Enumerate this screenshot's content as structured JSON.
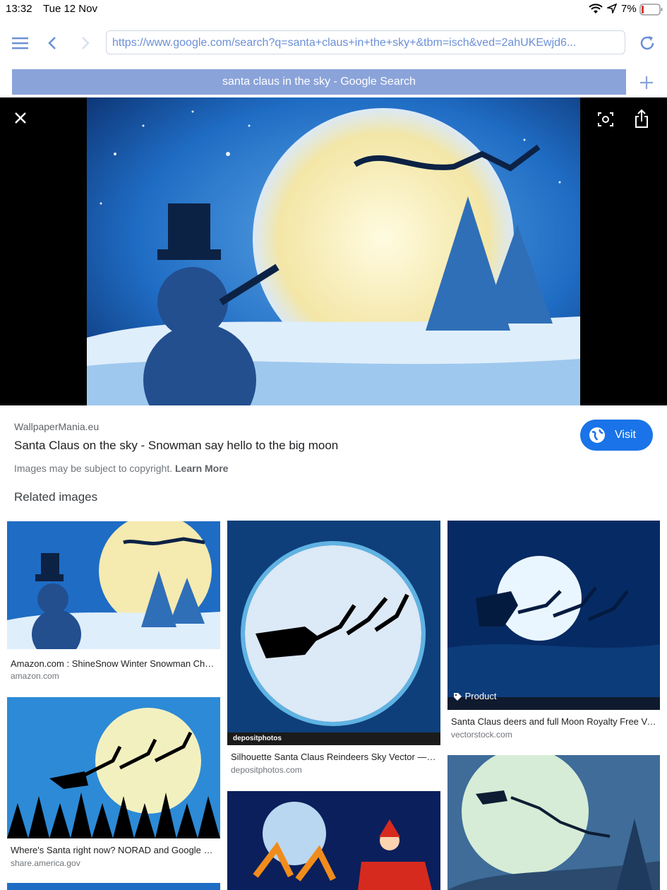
{
  "status_bar": {
    "time": "13:32",
    "date": "Tue 12 Nov",
    "battery": "7%"
  },
  "browser": {
    "url": "https://www.google.com/search?q=santa+claus+in+the+sky+&tbm=isch&ved=2ahUKEwjd6...",
    "tab_title": "santa claus in the sky - Google Search"
  },
  "result": {
    "source": "WallpaperMania.eu",
    "title": "Santa Claus on the sky - Snowman say hello to the big moon",
    "copyright": "Images may be subject to copyright.",
    "learn_more": "Learn More",
    "visit_label": "Visit"
  },
  "related_heading": "Related images",
  "related": [
    {
      "caption": "Amazon.com : ShineSnow Winter Snowman Chris...",
      "domain": "amazon.com"
    },
    {
      "caption": "Silhouette Santa Claus Reindeers Sky Vector — St...",
      "domain": "depositphotos.com",
      "watermark": "depositphotos"
    },
    {
      "caption": "Santa Claus deers and full Moon Royalty Free Vec...",
      "domain": "vectorstock.com",
      "badge": "Product"
    },
    {
      "caption": "Where's Santa right now? NORAD and Google kno...",
      "domain": "share.america.gov"
    }
  ]
}
